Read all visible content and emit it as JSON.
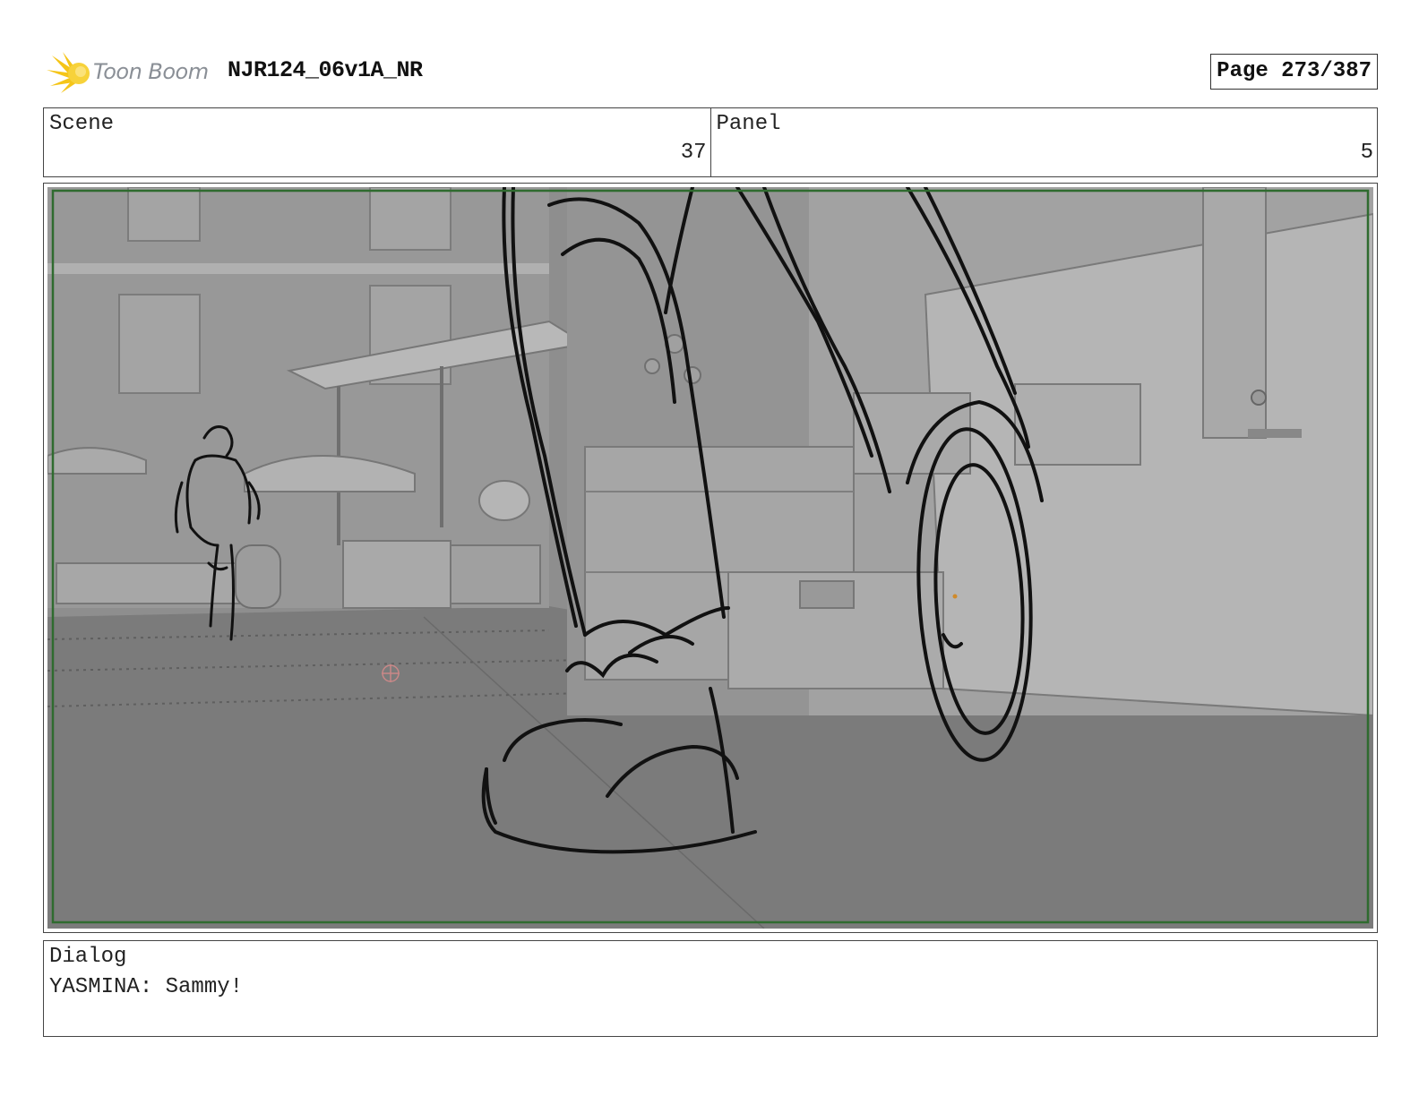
{
  "header": {
    "logo_text": "Toon Boom",
    "doc_title": "NJR124_06v1A_NR",
    "page": "Page 273/387"
  },
  "scene": {
    "label": "Scene",
    "value": "37"
  },
  "panel": {
    "label": "Panel",
    "value": "5"
  },
  "dialog": {
    "label": "Dialog",
    "text": "YASMINA: Sammy!"
  },
  "colors": {
    "safe_frame": "#2f6b2f",
    "background": "#8e8e8e",
    "ground": "#7b7b7b"
  }
}
